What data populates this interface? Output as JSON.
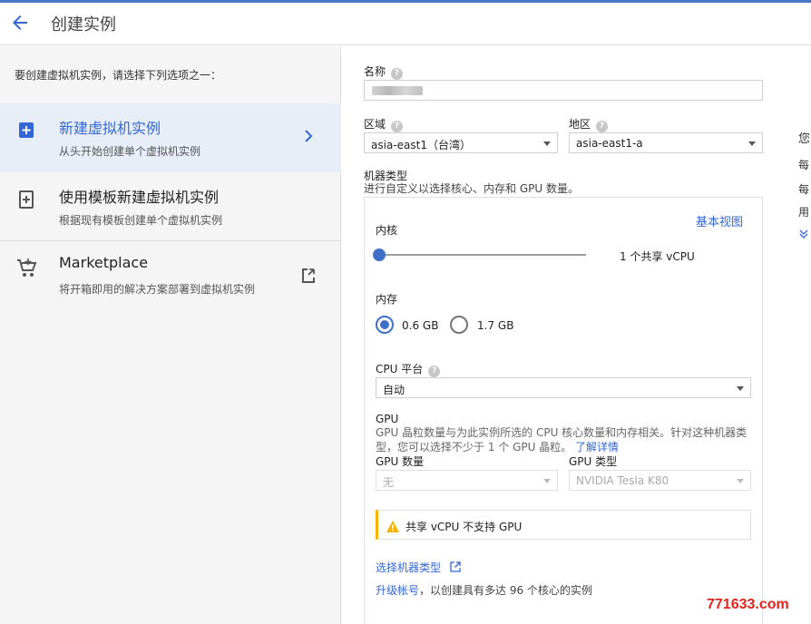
{
  "header": {
    "title": "创建实例"
  },
  "left": {
    "intro": "要创建虚拟机实例，请选择下列选项之一：",
    "options": [
      {
        "title": "新建虚拟机实例",
        "subtitle": "从头开始创建单个虚拟机实例"
      },
      {
        "title": "使用模板新建虚拟机实例",
        "subtitle": "根据现有模板创建单个虚拟机实例"
      },
      {
        "title": "Marketplace",
        "subtitle": "将开箱即用的解决方案部署到虚拟机实例"
      }
    ]
  },
  "form": {
    "name_label": "名称",
    "region_label": "区域",
    "region_value": "asia-east1（台湾）",
    "zone_label": "地区",
    "zone_value": "asia-east1-a",
    "machine_type_label": "机器类型",
    "machine_type_desc": "进行自定义以选择核心、内存和 GPU 数量。",
    "basic_view_link": "基本视图",
    "cores_label": "内核",
    "cores_value": "1 个共享 vCPU",
    "memory_label": "内存",
    "memory_options": [
      "0.6 GB",
      "1.7 GB"
    ],
    "memory_selected": "0.6 GB",
    "cpu_platform_label": "CPU 平台",
    "cpu_platform_value": "自动",
    "gpu_title": "GPU",
    "gpu_desc": "GPU 晶粒数量与为此实例所选的 CPU 核心数量和内存相关。针对这种机器类型，您可以选择不少于 1 个 GPU 晶粒。",
    "gpu_learn_more": "了解详情",
    "gpu_count_label": "GPU 数量",
    "gpu_count_value": "无",
    "gpu_type_label": "GPU 类型",
    "gpu_type_value": "NVIDIA Tesla K80",
    "warning_text": "共享 vCPU 不支持 GPU",
    "select_machine_type_link": "选择机器类型",
    "upgrade_link": "升级帐号",
    "upgrade_text": "，以创建具有多达 96 个核心的实例"
  },
  "right_cut": {
    "chars": [
      "您",
      "每",
      "每",
      "用"
    ]
  },
  "watermark": "771633.com",
  "colors": {
    "accent": "#3f70c9",
    "selected_bg": "#e8eef8",
    "warning": "#f4b400",
    "link": "#3367d6"
  }
}
